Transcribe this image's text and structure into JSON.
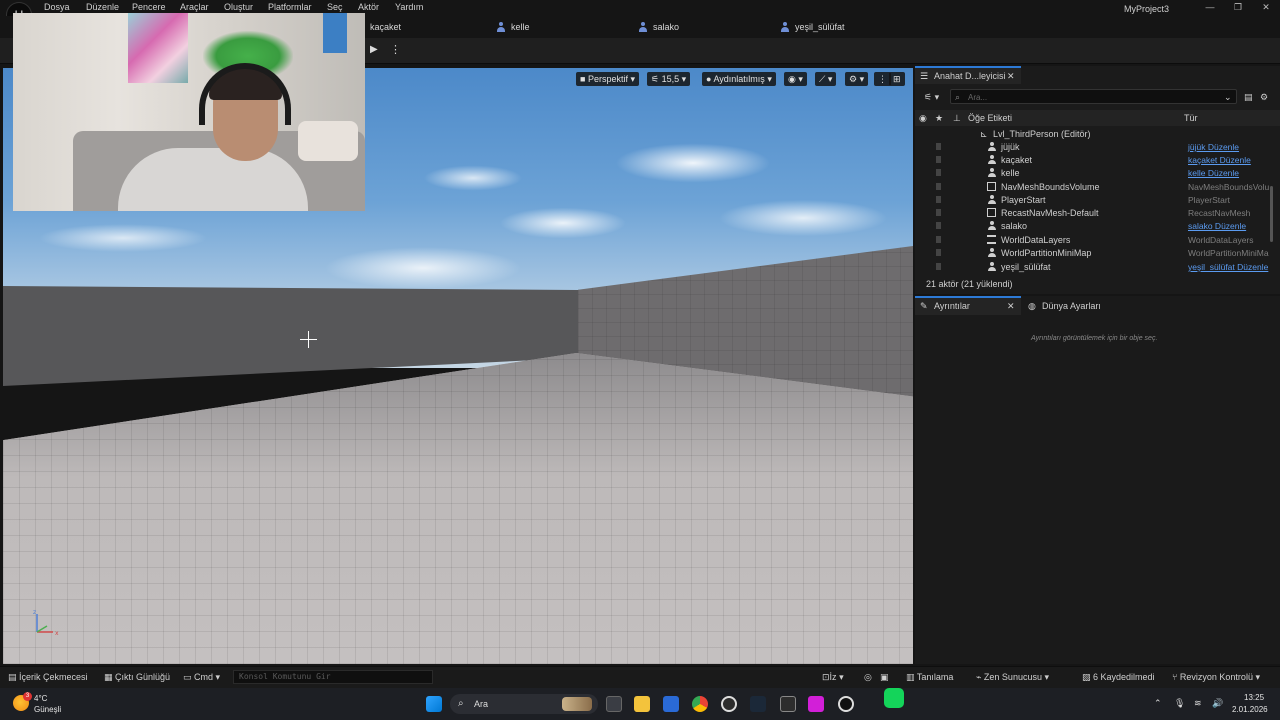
{
  "menu": {
    "items": [
      "Dosya",
      "Düzenle",
      "Pencere",
      "Araçlar",
      "Oluştur",
      "Platformlar",
      "Seç",
      "Aktör",
      "Yardım"
    ],
    "project_title": "MyProject3"
  },
  "level_tabs": [
    "kaçaket",
    "kelle",
    "salako",
    "yeşil_sülüfat"
  ],
  "viewport": {
    "perspective": "Perspektif",
    "fov": "15,5",
    "lit_mode": "Aydınlatılmış"
  },
  "outliner": {
    "tab_title": "Anahat D...leyicisi",
    "search_placeholder": "Ara...",
    "col_label": "Öğe Etiketi",
    "col_type": "Tür",
    "level_name": "Lvl_ThirdPerson (Editör)",
    "rows": [
      {
        "name": "jüjük",
        "type": "jüjük Düzenle",
        "link": true,
        "icon": "person"
      },
      {
        "name": "kaçaket",
        "type": "kaçaket Düzenle",
        "link": true,
        "icon": "person"
      },
      {
        "name": "kelle",
        "type": "kelle Düzenle",
        "link": true,
        "icon": "person"
      },
      {
        "name": "NavMeshBoundsVolume",
        "type": "NavMeshBoundsVolu",
        "link": false,
        "icon": "box"
      },
      {
        "name": "PlayerStart",
        "type": "PlayerStart",
        "link": false,
        "icon": "person"
      },
      {
        "name": "RecastNavMesh-Default",
        "type": "RecastNavMesh",
        "link": false,
        "icon": "box"
      },
      {
        "name": "salako",
        "type": "salako Düzenle",
        "link": true,
        "icon": "person"
      },
      {
        "name": "WorldDataLayers",
        "type": "WorldDataLayers",
        "link": false,
        "icon": "layers"
      },
      {
        "name": "WorldPartitionMiniMap",
        "type": "WorldPartitionMiniMa",
        "link": false,
        "icon": "person"
      },
      {
        "name": "yeşil_sülüfat",
        "type": "yeşil_sülüfat Düzenle",
        "link": true,
        "icon": "person"
      }
    ],
    "actor_count": "21 aktör (21 yüklendi)"
  },
  "details": {
    "tab_details": "Ayrıntılar",
    "tab_world": "Dünya Ayarları",
    "empty_hint": "Ayrıntıları görüntülemek için bir obje seç."
  },
  "statusbar": {
    "content_drawer": "İçerik Çekmecesi",
    "output_log": "Çıktı Günlüğü",
    "cmd": "Cmd",
    "cmd_placeholder": "Konsol Komutunu Gir",
    "trace": "İz",
    "diagnose": "Tanılama",
    "zen": "Zen Sunucusu",
    "unsaved": "6 Kaydedilmedi",
    "revision": "Revizyon Kontrolü"
  },
  "taskbar": {
    "temp": "4°C",
    "weather": "Güneşli",
    "weather_badge": "3",
    "search": "Ara",
    "time": "13:25",
    "date": "2.01.2026"
  }
}
